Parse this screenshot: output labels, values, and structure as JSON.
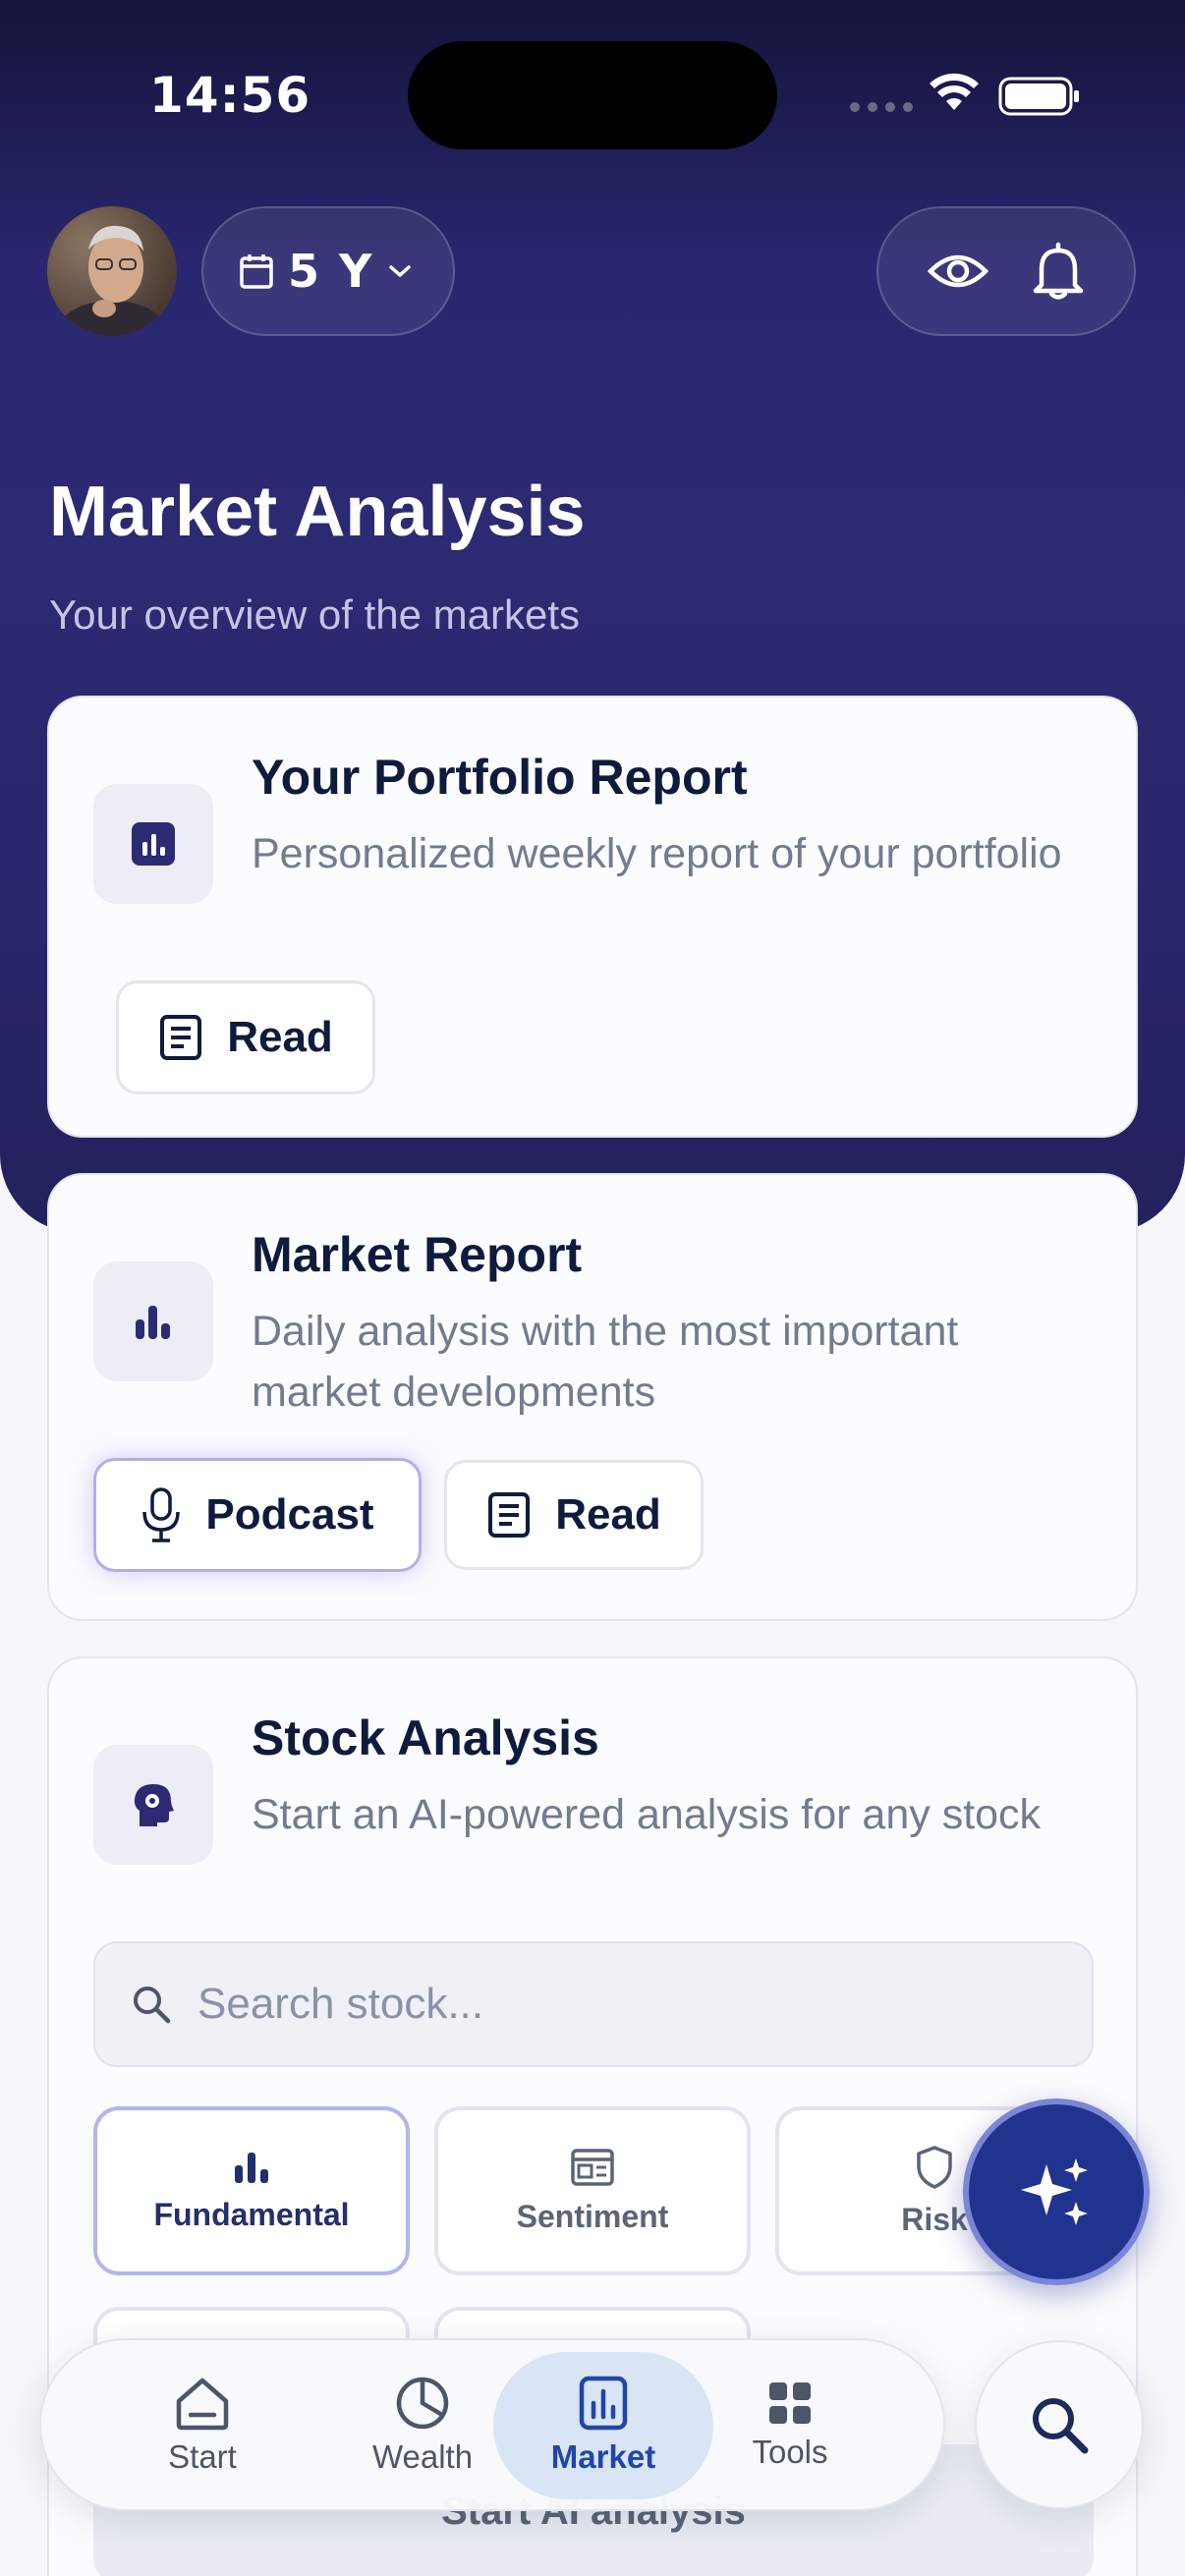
{
  "status": {
    "time": "14:56"
  },
  "header": {
    "period_label": "5 Y"
  },
  "page": {
    "title": "Market Analysis",
    "subtitle": "Your overview of the markets"
  },
  "portfolio_card": {
    "title": "Your Portfolio Report",
    "description": "Personalized weekly report of your portfolio",
    "read_label": "Read"
  },
  "market_card": {
    "title": "Market Report",
    "description": "Daily analysis with the most important market developments",
    "podcast_label": "Podcast",
    "read_label": "Read"
  },
  "stock_card": {
    "title": "Stock Analysis",
    "description": "Start an AI-powered analysis for any stock",
    "search_placeholder": "Search stock...",
    "types": [
      {
        "label": "Fundamental",
        "icon": "bar-chart-icon"
      },
      {
        "label": "Sentiment",
        "icon": "newspaper-icon"
      },
      {
        "label": "Risk",
        "icon": "shield-icon"
      }
    ],
    "start_label": "Start AI analysis"
  },
  "tabbar": {
    "items": [
      {
        "label": "Start",
        "icon": "home-icon"
      },
      {
        "label": "Wealth",
        "icon": "pie-chart-icon"
      },
      {
        "label": "Market",
        "icon": "market-chart-icon"
      },
      {
        "label": "Tools",
        "icon": "grid-icon"
      }
    ],
    "active": "Market"
  },
  "colors": {
    "hero_gradient_top": "#14143a",
    "hero_gradient": "#2c2a72",
    "accent": "#20348f",
    "active_tab_bg": "#d9e4f5",
    "active_tab_text": "#2146a8"
  }
}
